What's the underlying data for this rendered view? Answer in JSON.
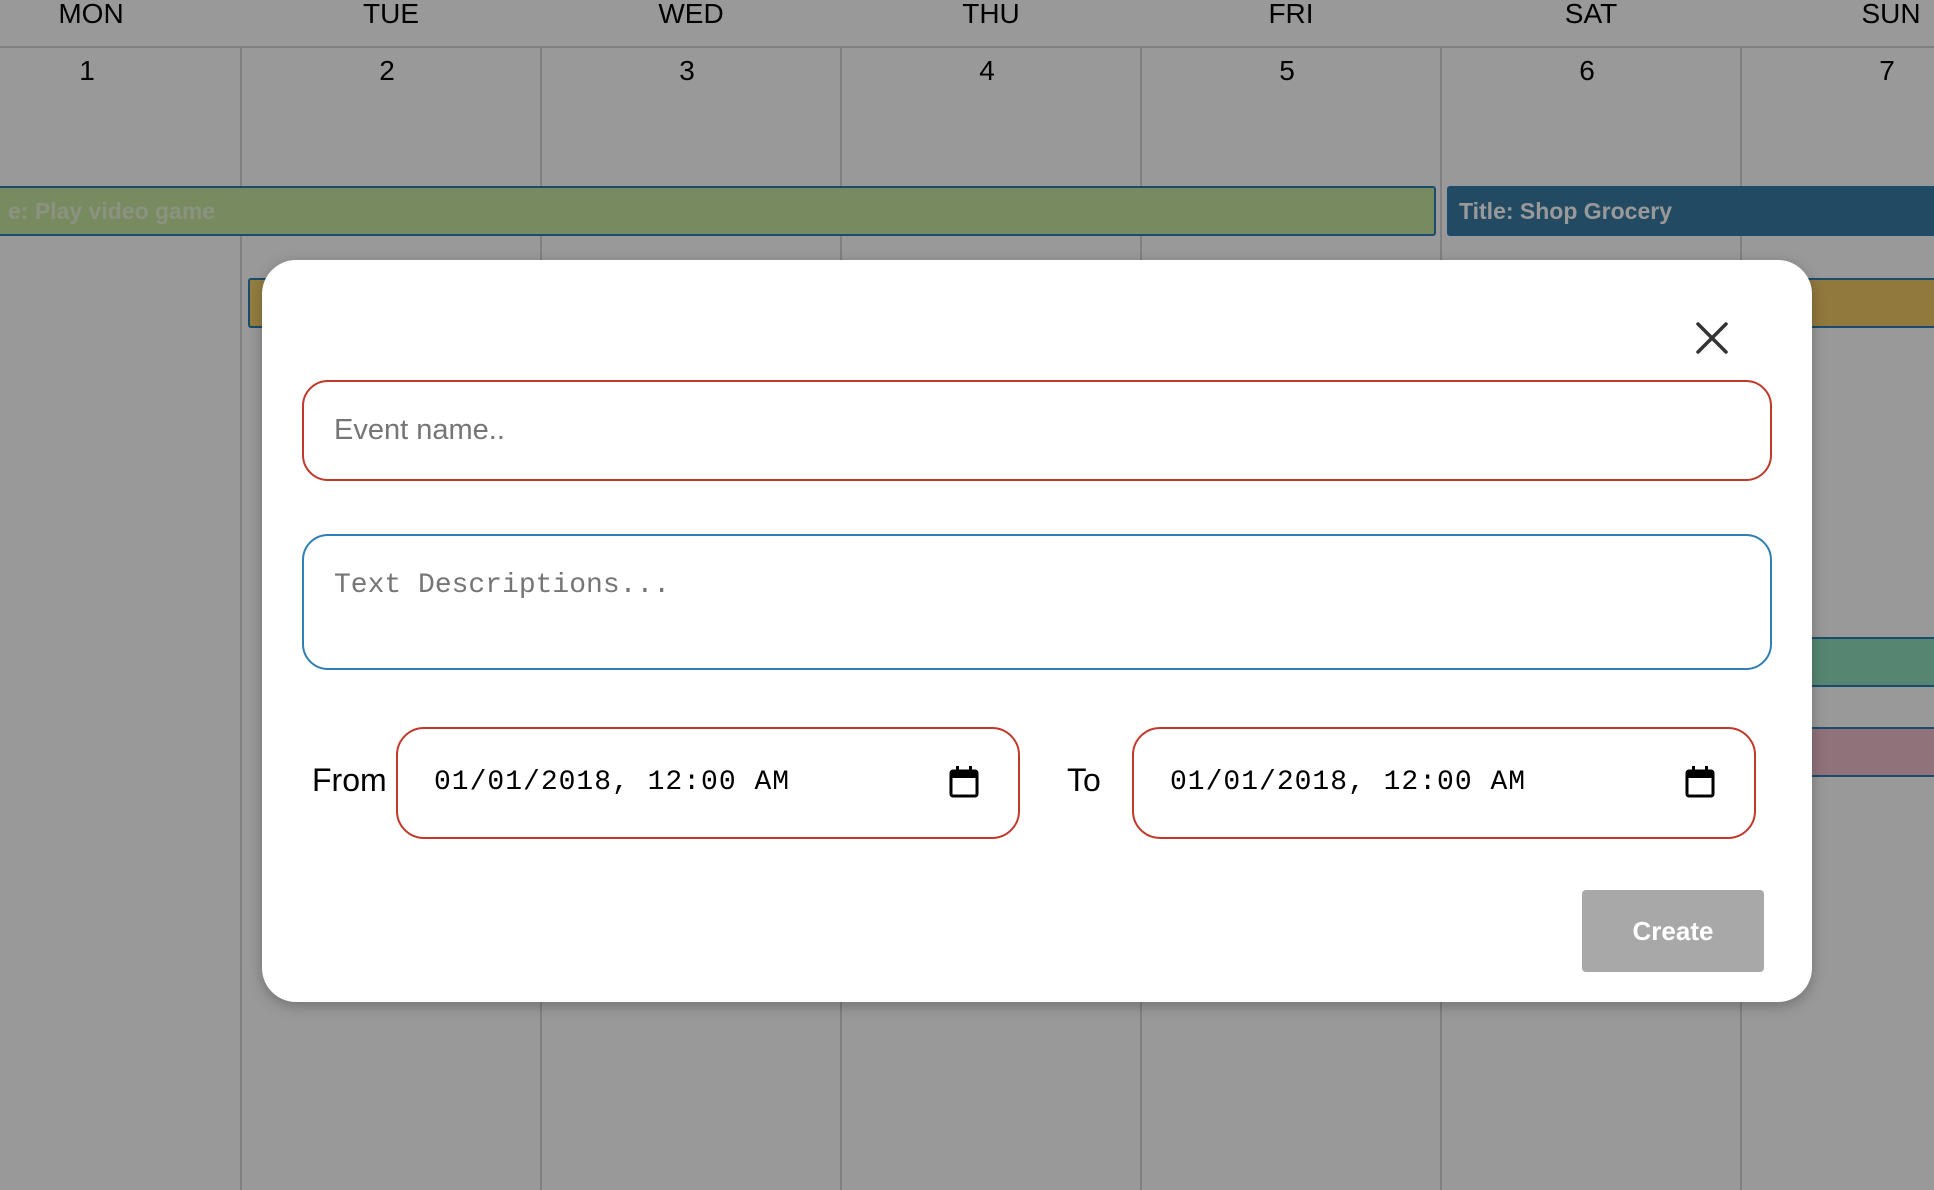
{
  "calendar": {
    "days": [
      {
        "name": "MON",
        "num": "1"
      },
      {
        "name": "TUE",
        "num": "2"
      },
      {
        "name": "WED",
        "num": "3"
      },
      {
        "name": "THU",
        "num": "4"
      },
      {
        "name": "FRI",
        "num": "5"
      },
      {
        "name": "SAT",
        "num": "6"
      },
      {
        "name": "SUN",
        "num": "7"
      }
    ],
    "events": {
      "video_game": "e: Play video game",
      "grocery": "Title: Shop Grocery"
    },
    "event_colors": {
      "video_game": "#c8e6a0",
      "grocery": "#3a7ea6",
      "yellow": "#f6d36b",
      "green": "#8fe0bd",
      "pink": "#f1bfcd"
    }
  },
  "modal": {
    "close_label": "X",
    "event_name_placeholder": "Event name..",
    "description_placeholder": "Text Descriptions...",
    "from_label": "From",
    "to_label": "To",
    "from_value": "01/01/2018, 12:00 AM",
    "to_value": "01/01/2018, 12:00 AM",
    "create_label": "Create",
    "colors": {
      "invalid_border": "#c0392b",
      "focus_border": "#2f7fb6",
      "disabled_button": "#a8a8a8"
    }
  }
}
